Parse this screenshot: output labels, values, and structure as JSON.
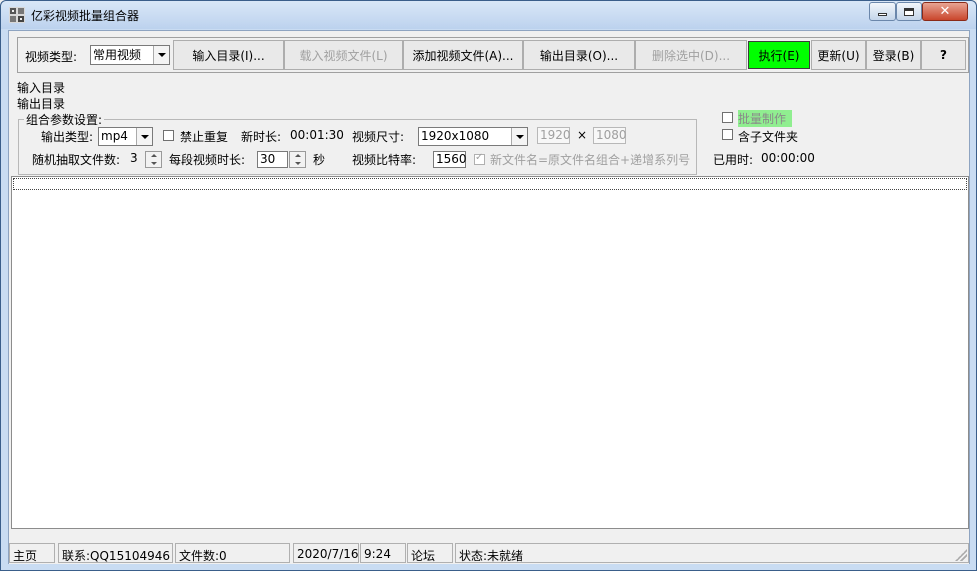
{
  "window": {
    "title": "亿彩视频批量组合器"
  },
  "toolbar": {
    "video_type_label": "视频类型:",
    "video_type_value": "常用视频",
    "buttons": [
      {
        "label": "输入目录(I)...",
        "enabled": true
      },
      {
        "label": "载入视频文件(L)",
        "enabled": false
      },
      {
        "label": "添加视频文件(A)...",
        "enabled": true
      },
      {
        "label": "输出目录(O)...",
        "enabled": true
      },
      {
        "label": "删除选中(D)...",
        "enabled": false
      },
      {
        "label": "执行(E)",
        "enabled": true,
        "highlight": "#00ff00"
      },
      {
        "label": "更新(U)",
        "enabled": true
      },
      {
        "label": "登录(B)",
        "enabled": true
      },
      {
        "label": "?",
        "enabled": true
      }
    ]
  },
  "info": {
    "input_dir_label": "输入目录",
    "output_dir_label": "输出目录"
  },
  "settings": {
    "group_title": "组合参数设置:",
    "output_type_label": "输出类型:",
    "output_type_value": "mp4",
    "no_repeat_label": "禁止重复",
    "new_duration_label": "新时长:",
    "new_duration_value": "00:01:30",
    "video_size_label": "视频尺寸:",
    "video_size_value": "1920x1080",
    "width_value": "1920",
    "times_sign": "×",
    "height_value": "1080",
    "random_files_label": "随机抽取文件数:",
    "random_files_value": "3",
    "segment_duration_label": "每段视频时长:",
    "segment_duration_value": "30",
    "seconds_unit": "秒",
    "bitrate_label": "视频比特率:",
    "bitrate_value": "1560",
    "filename_option_label": "新文件名=原文件名组合+递增系列号"
  },
  "right_panel": {
    "batch_label": "批量制作",
    "batch_highlight": "#90ee90",
    "subfolder_label": "含子文件夹",
    "elapsed_label": "已用时:",
    "elapsed_value": "00:00:00"
  },
  "statusbar": {
    "home": "主页",
    "contact": "联系:QQ15104946",
    "file_count": "文件数:0",
    "date": "2020/7/16",
    "time": "9:24",
    "forum": "论坛",
    "status": "状态:未就绪"
  }
}
